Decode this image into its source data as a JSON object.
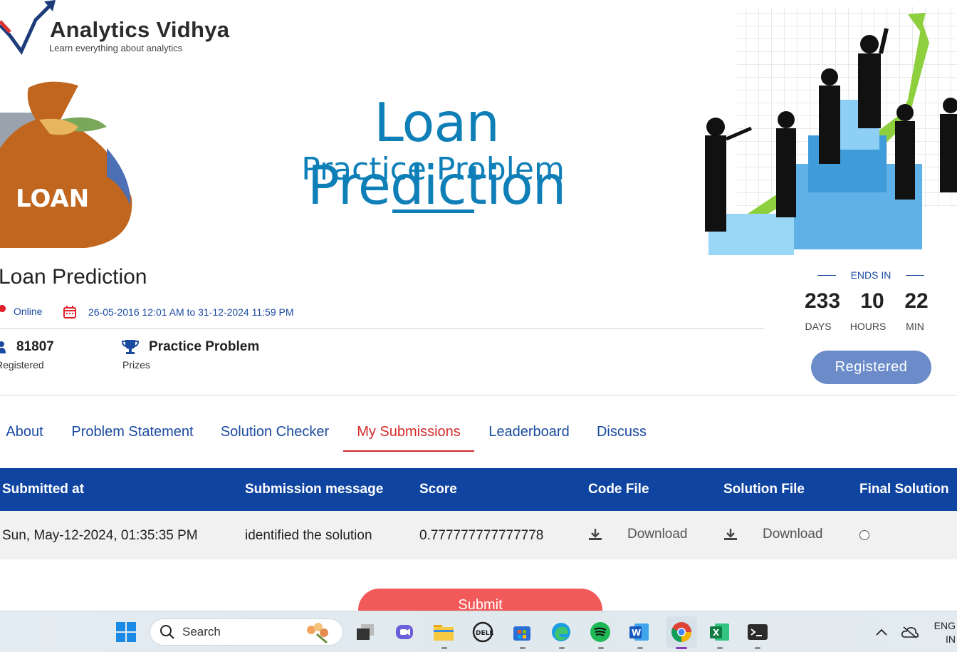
{
  "brand": {
    "name": "Analytics Vidhya",
    "tagline": "Learn everything about analytics"
  },
  "banner": {
    "bag_label": "LOAN",
    "title": "Loan Prediction",
    "subtitle": "Practice Problem"
  },
  "hackathon": {
    "title": "Loan Prediction",
    "mode": "Online",
    "date_range": "26-05-2016 12:01 AM to 31-12-2024 11:59 PM",
    "registered_count": "81807",
    "registered_label": "Registered",
    "prize_value": "Practice Problem",
    "prize_label": "Prizes"
  },
  "countdown": {
    "heading": "ENDS IN",
    "days": "233",
    "days_label": "DAYS",
    "hours": "10",
    "hours_label": "HOURS",
    "minutes": "22",
    "minutes_label": "MIN",
    "button_label": "Registered"
  },
  "tabs": [
    {
      "label": "About"
    },
    {
      "label": "Problem Statement"
    },
    {
      "label": "Solution Checker"
    },
    {
      "label": "My Submissions",
      "active": true
    },
    {
      "label": "Leaderboard"
    },
    {
      "label": "Discuss"
    }
  ],
  "table": {
    "headers": [
      "Submitted at",
      "Submission message",
      "Score",
      "Code File",
      "Solution File",
      "Final Solution"
    ],
    "rows": [
      {
        "submitted_at": "Sun, May-12-2024, 01:35:35 PM",
        "message": "identified the solution",
        "score": "0.777777777777778",
        "code_file": "Download",
        "solution_file": "Download"
      }
    ]
  },
  "submit_label": "Submit",
  "taskbar": {
    "search_placeholder": "Search",
    "lang_line1": "ENG",
    "lang_line2": "IN"
  },
  "colors": {
    "primary_blue": "#0f44a0",
    "link_blue": "#1a4aa0",
    "active_tab_red": "#d42a2a",
    "submit_red": "#f25a5a",
    "registered_btn": "#6b8cc9",
    "banner_blue": "#0f7fb8"
  }
}
